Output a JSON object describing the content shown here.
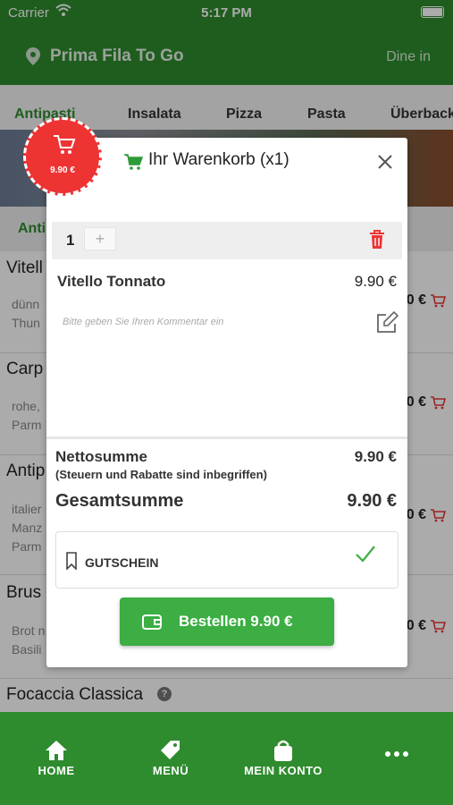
{
  "status_bar": {
    "carrier": "Carrier",
    "time": "5:17 PM"
  },
  "header": {
    "store_name": "Prima Fila To Go",
    "mode": "Dine in"
  },
  "categories": [
    "Antipasti",
    "Insalata",
    "Pizza",
    "Pasta",
    "Überback"
  ],
  "subcategory": "Anti",
  "menu_items": [
    {
      "name": "Vitell",
      "desc1": "dünn",
      "desc2": "Thun",
      "price": "0 €"
    },
    {
      "name": "Carp",
      "desc1": "rohe,",
      "desc2": "Parm",
      "price": "0 €"
    },
    {
      "name": "Antip",
      "desc1": "italier",
      "desc2": "Manz",
      "desc3": "Parm",
      "price": "0 €"
    },
    {
      "name": "Brus",
      "desc1": "Brot n",
      "desc2": "Basili",
      "price": "0 €"
    },
    {
      "name": "Focaccia Classica"
    }
  ],
  "badge_price": "9.90 €",
  "modal": {
    "title": "Ihr Warenkorb (x1)",
    "quantity": "1",
    "plus": "+",
    "item_name": "Vitello Tonnato",
    "item_price": "9.90 €",
    "comment_placeholder": "Bitte geben Sie Ihren Kommentar ein",
    "net_label": "Nettosumme",
    "net_value": "9.90 €",
    "tax_note": "(Steuern und Rabatte sind inbegriffen)",
    "total_label": "Gesamtsumme",
    "total_value": "9.90 €",
    "voucher_label": "GUTSCHEIN",
    "order_label": "Bestellen 9.90 €"
  },
  "bottom_nav": [
    {
      "label": "HOME",
      "icon": "home-icon"
    },
    {
      "label": "MENÜ",
      "icon": "tag-icon"
    },
    {
      "label": "MEIN KONTO",
      "icon": "bag-icon"
    },
    {
      "label": "",
      "icon": "more-icon"
    }
  ],
  "colors": {
    "brand_green": "#2e8b2e",
    "button_green": "#3cae44",
    "accent_red": "#e33333"
  }
}
